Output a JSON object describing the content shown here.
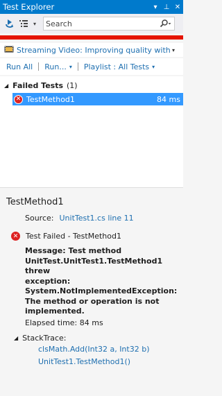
{
  "window": {
    "title": "Test Explorer",
    "dropdown_glyph": "▾",
    "pin_glyph": "⊥",
    "close_glyph": "✕"
  },
  "toolbar": {
    "search_placeholder": "Search",
    "dropdown_glyph": "▾"
  },
  "status": {
    "color": "#e51400"
  },
  "playlist_banner": {
    "text": "Streaming Video: Improving quality with u",
    "dropdown_glyph": "▾"
  },
  "actions": {
    "run_all": "Run All",
    "run": "Run...",
    "run_caret": "▾",
    "playlist": "Playlist : All Tests",
    "playlist_caret": "▾"
  },
  "test_list": {
    "group": {
      "expand_glyph": "◢",
      "title": "Failed Tests",
      "count": "(1)"
    },
    "tests": [
      {
        "name": "TestMethod1",
        "duration": "84 ms",
        "status": "failed"
      }
    ]
  },
  "detail": {
    "title": "TestMethod1",
    "source_label": "Source:",
    "source_link": "UnitTest1.cs line 11",
    "status_text": "Test Failed - TestMethod1",
    "message_lines": [
      "Message: Test method",
      "UnitTest.UnitTest1.TestMethod1 threw",
      "exception:",
      "System.NotImplementedException:",
      "The method or operation is not",
      "implemented."
    ],
    "elapsed": "Elapsed time: 84 ms",
    "stack_label": "StackTrace:",
    "stack_glyph": "◢",
    "stack_frames": [
      "clsMath.Add(Int32 a, Int32 b)",
      "UnitTest1.TestMethod1()"
    ]
  },
  "colors": {
    "title_bar": "#007acc",
    "selection": "#3399ff",
    "link": "#1e6fb0",
    "failed": "#dd2222",
    "status_bar": "#e51400"
  },
  "icons": {
    "fail": "✕"
  }
}
